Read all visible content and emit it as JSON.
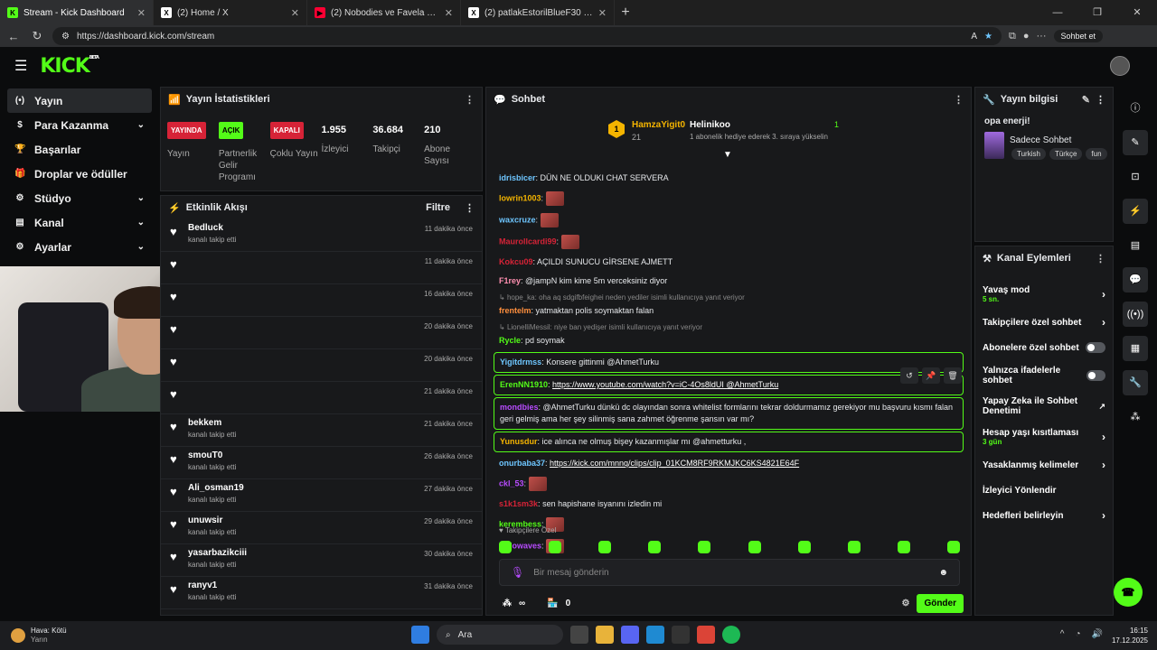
{
  "browser": {
    "tabs": [
      {
        "title": "Stream - Kick Dashboard",
        "fav": "K",
        "color": "#53fc18",
        "active": true
      },
      {
        "title": "(2) Home / X",
        "fav": "X",
        "color": "#ffffff",
        "active": false
      },
      {
        "title": "(2) Nobodies ve Favela Çatışması:",
        "fav": "▶",
        "color": "#ff0033",
        "active": false
      },
      {
        "title": "(2) patlakEstorilBlueF30 on X: \"son",
        "fav": "X",
        "color": "#ffffff",
        "active": false
      }
    ],
    "url": "https://dashboard.kick.com/stream",
    "sohbet_button": "Sohbet et"
  },
  "app": {
    "logo": "KICK",
    "beta": "BETA"
  },
  "sidebar": {
    "items": [
      {
        "label": "Yayın",
        "icon": "(•)",
        "chev": ""
      },
      {
        "label": "Para Kazanma",
        "icon": "$",
        "chev": "⌄"
      },
      {
        "label": "Başarılar",
        "icon": "🏆",
        "chev": ""
      },
      {
        "label": "Droplar ve ödüller",
        "icon": "🎁",
        "chev": ""
      },
      {
        "label": "Stüdyo",
        "icon": "⚙",
        "chev": "⌄"
      },
      {
        "label": "Kanal",
        "icon": "▤",
        "chev": "⌄"
      },
      {
        "label": "Ayarlar",
        "icon": "⚙",
        "chev": "⌄"
      }
    ]
  },
  "stats": {
    "title": "Yayın İstatistikleri",
    "cols": [
      {
        "badge": "YAYINDA",
        "badge_class": "b-red",
        "label": "Yayın"
      },
      {
        "badge": "AÇIK",
        "badge_class": "b-green",
        "label": "Partnerlik Gelir Programı"
      },
      {
        "badge": "KAPALI",
        "badge_class": "b-red",
        "label": "Çoklu Yayın"
      },
      {
        "num": "1.955",
        "label": "İzleyici"
      },
      {
        "num": "36.684",
        "label": "Takipçi"
      },
      {
        "num": "210",
        "label": "Abone Sayısı"
      }
    ]
  },
  "activity": {
    "title": "Etkinlik Akışı",
    "filter": "Filtre",
    "rows": [
      {
        "name": "Bedluck",
        "sub": "kanalı takip etti",
        "time": "11 dakika önce"
      },
      {
        "name": "",
        "sub": "",
        "time": "11 dakika önce"
      },
      {
        "name": "",
        "sub": "",
        "time": "16 dakika önce"
      },
      {
        "name": "",
        "sub": "",
        "time": "20 dakika önce"
      },
      {
        "name": "",
        "sub": "",
        "time": "20 dakika önce"
      },
      {
        "name": "",
        "sub": "",
        "time": "21 dakika önce"
      },
      {
        "name": "bekkem",
        "sub": "kanalı takip etti",
        "time": "21 dakika önce"
      },
      {
        "name": "smouT0",
        "sub": "kanalı takip etti",
        "time": "26 dakika önce"
      },
      {
        "name": "Ali_osman19",
        "sub": "kanalı takip etti",
        "time": "27 dakika önce"
      },
      {
        "name": "unuwsir",
        "sub": "kanalı takip etti",
        "time": "29 dakika önce"
      },
      {
        "name": "yasarbazikciii",
        "sub": "kanalı takip etti",
        "time": "30 dakika önce"
      },
      {
        "name": "ranyv1",
        "sub": "kanalı takip etti",
        "time": "31 dakika önce"
      }
    ]
  },
  "chat": {
    "title": "Sohbet",
    "gifter": {
      "rank": "1",
      "name": "HamzaYigit0",
      "count": "21",
      "name2": "Helinikoo",
      "count2": "1",
      "desc": "1 abonelik hediye ederek 3. sıraya yükselin"
    },
    "messages": [
      {
        "user": "idrisbicer",
        "color": "#6ec6ff",
        "text": "DÜN NE OLDUKI CHAT SERVERA",
        "emote": false,
        "hl": false,
        "reply": ""
      },
      {
        "user": "lowrin1003",
        "color": "#f4b400",
        "text": "",
        "emote": true,
        "hl": false,
        "reply": ""
      },
      {
        "user": "waxcruze",
        "color": "#6ec6ff",
        "text": "",
        "emote": true,
        "hl": false,
        "reply": ""
      },
      {
        "user": "Maurollcardi99",
        "color": "#d62337",
        "text": "",
        "emote": true,
        "hl": false,
        "reply": ""
      },
      {
        "user": "Kokcu09",
        "color": "#d62337",
        "text": "AÇILDI SUNUCU GİRSENE AJMETT",
        "emote": false,
        "hl": false,
        "reply": ""
      },
      {
        "user": "F1rey",
        "color": "#ff8fb0",
        "text": "@jampN kim kime 5m verceksiniz diyor",
        "emote": false,
        "hl": false,
        "reply": ""
      },
      {
        "user": "frentelm",
        "color": "#ff8f3d",
        "text": "yatmaktan polis soymaktan falan",
        "emote": false,
        "hl": false,
        "reply": "hope_ka: oha aq sdgifbfeighei neden yediler isimli kullanıcıya yanıt veriyor"
      },
      {
        "user": "Rycle",
        "color": "#53fc18",
        "text": "pd soymak",
        "emote": false,
        "hl": false,
        "reply": "LionelliMessil: niye ban yedişer isimli kullanıcıya yanıt veriyor"
      },
      {
        "user": "Yigitdrmss",
        "color": "#6ec6ff",
        "text": "Konsere gittinmi @AhmetTurku",
        "emote": false,
        "hl": true,
        "reply": ""
      },
      {
        "user": "ErenNN1910",
        "color": "#53fc18",
        "text": "https://www.youtube.com/watch?v=iC-4Os8ldUI @AhmetTurku",
        "emote": false,
        "hl": true,
        "reply": ""
      },
      {
        "user": "mondbies",
        "color": "#b84cff",
        "text": "@AhmetTurku dünkü dc olayından sonra whitelist formlarını tekrar doldurmamız gerekiyor mu başvuru kısmı falan geri gelmiş ama her şey silinmiş sana zahmet öğrenme şansın var mı?",
        "emote": false,
        "hl": true,
        "reply": ""
      },
      {
        "user": "Yunusdur",
        "color": "#f4b400",
        "text": "ice alınca ne olmuş bişey kazanmışlar mı @ahmetturku ,",
        "emote": false,
        "hl": true,
        "reply": ""
      },
      {
        "user": "onurbaba37",
        "color": "#6ec6ff",
        "text": "https://kick.com/mnnq/clips/clip_01KCM8RF9RKMJKC6KS4821E64F",
        "emote": false,
        "hl": false,
        "reply": ""
      },
      {
        "user": "ckl_53",
        "color": "#b84cff",
        "text": "",
        "emote": true,
        "hl": false,
        "reply": ""
      },
      {
        "user": "s1k1sm3k",
        "color": "#d62337",
        "text": "sen hapishane isyanını izledin mi",
        "emote": false,
        "hl": false,
        "reply": ""
      },
      {
        "user": "kerembess",
        "color": "#53fc18",
        "text": "",
        "emote": true,
        "hl": false,
        "reply": ""
      },
      {
        "user": "willowaves",
        "color": "#b84cff",
        "text": "",
        "emote": true,
        "hl": false,
        "reply": ""
      }
    ],
    "followers_only": "Takipçilere Özel",
    "input_placeholder": "Bir mesaj gönderin",
    "foot_infinity": "∞",
    "foot_count": "0",
    "send": "Gönder"
  },
  "info": {
    "title": "Yayın bilgisi",
    "stream_title": "opa enerji!",
    "category": "Sadece Sohbet",
    "tags": [
      "Turkish",
      "Türkçe",
      "fun"
    ]
  },
  "actions": {
    "title": "Kanal Eylemleri",
    "items": [
      {
        "label": "Yavaş mod",
        "sub": "5 sn.",
        "kind": "chev"
      },
      {
        "label": "Takipçilere özel sohbet",
        "sub": "",
        "kind": "chev"
      },
      {
        "label": "Abonelere özel sohbet",
        "sub": "",
        "kind": "toggle"
      },
      {
        "label": "Yalnızca ifadelerle sohbet",
        "sub": "",
        "kind": "toggle"
      },
      {
        "label": "Yapay Zeka ile Sohbet Denetimi",
        "sub": "",
        "kind": "ext"
      },
      {
        "label": "Hesap yaşı kısıtlaması",
        "sub": "3 gün",
        "kind": "chev"
      },
      {
        "label": "Yasaklanmış kelimeler",
        "sub": "",
        "kind": "chev"
      },
      {
        "label": "İzleyici Yönlendir",
        "sub": "",
        "kind": "none"
      },
      {
        "label": "Hedefleri belirleyin",
        "sub": "",
        "kind": "chev"
      }
    ]
  },
  "taskbar": {
    "weather1": "Hava: Kötü",
    "weather2": "Yarın",
    "search": "Ara",
    "time": "16:15",
    "date": "17.12.2025"
  }
}
